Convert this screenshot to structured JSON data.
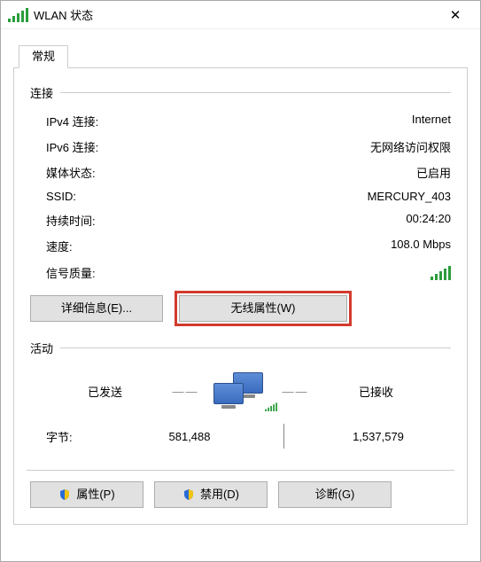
{
  "window": {
    "title": "WLAN 状态",
    "close": "✕"
  },
  "tabs": {
    "general": "常规"
  },
  "sections": {
    "connection": "连接",
    "activity": "活动"
  },
  "connection": {
    "ipv4_label": "IPv4 连接:",
    "ipv4_value": "Internet",
    "ipv6_label": "IPv6 连接:",
    "ipv6_value": "无网络访问权限",
    "media_label": "媒体状态:",
    "media_value": "已启用",
    "ssid_label": "SSID:",
    "ssid_value": "MERCURY_403",
    "duration_label": "持续时间:",
    "duration_value": "00:24:20",
    "speed_label": "速度:",
    "speed_value": "108.0 Mbps",
    "signal_label": "信号质量:"
  },
  "buttons": {
    "details": "详细信息(E)...",
    "wireless": "无线属性(W)",
    "properties": "属性(P)",
    "disable": "禁用(D)",
    "diagnose": "诊断(G)"
  },
  "activity": {
    "sent_label": "已发送",
    "received_label": "已接收",
    "bytes_label": "字节:",
    "sent_value": "581,488",
    "received_value": "1,537,579"
  }
}
